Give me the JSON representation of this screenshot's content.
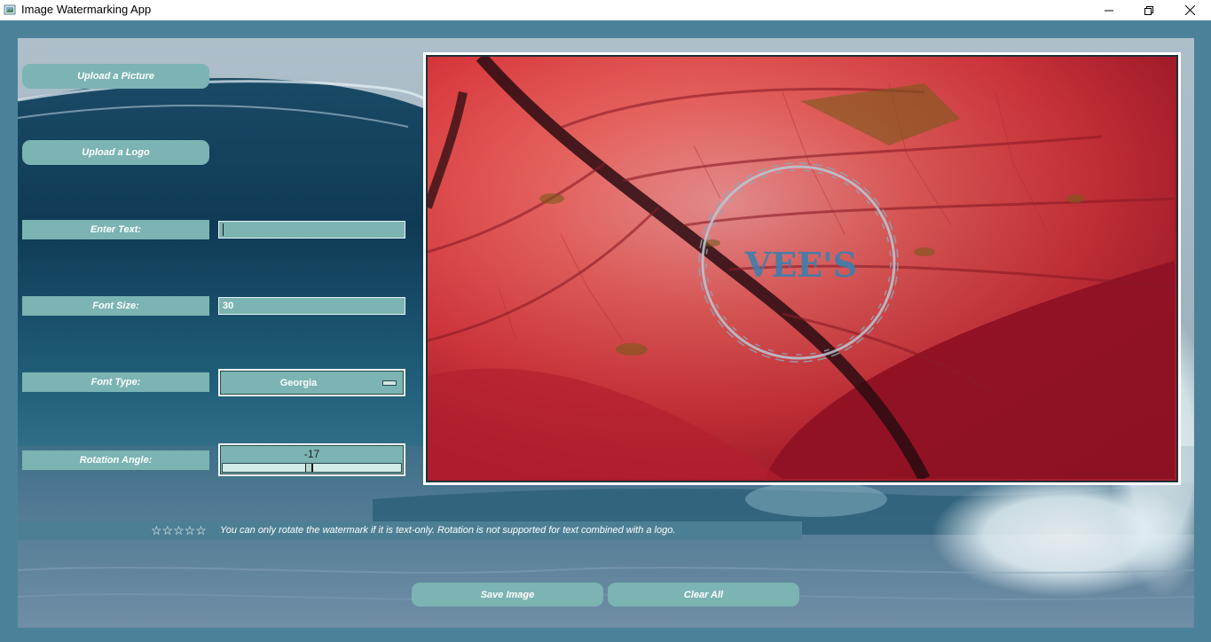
{
  "window": {
    "title": "Image Watermarking App"
  },
  "controls": {
    "upload_picture": "Upload a Picture",
    "upload_logo": "Upload a Logo",
    "enter_text_label": "Enter Text:",
    "enter_text_value": "",
    "font_size_label": "Font Size:",
    "font_size_value": "30",
    "font_type_label": "Font Type:",
    "font_type_value": "Georgia",
    "rotation_label": "Rotation Angle:",
    "rotation_value": "-17"
  },
  "preview": {
    "watermark_text": "VEE'S"
  },
  "note": {
    "stars": "☆☆☆☆☆",
    "text": "You can only rotate the watermark if it is text-only. Rotation is not supported for text combined with a logo."
  },
  "actions": {
    "save": "Save Image",
    "clear": "Clear All"
  },
  "colors": {
    "accent": "#7bb4b2",
    "frame": "#4b8299"
  },
  "icons": {
    "app": "app-icon",
    "minimize": "minimize-icon",
    "maximize": "restore-icon",
    "close": "close-icon"
  }
}
